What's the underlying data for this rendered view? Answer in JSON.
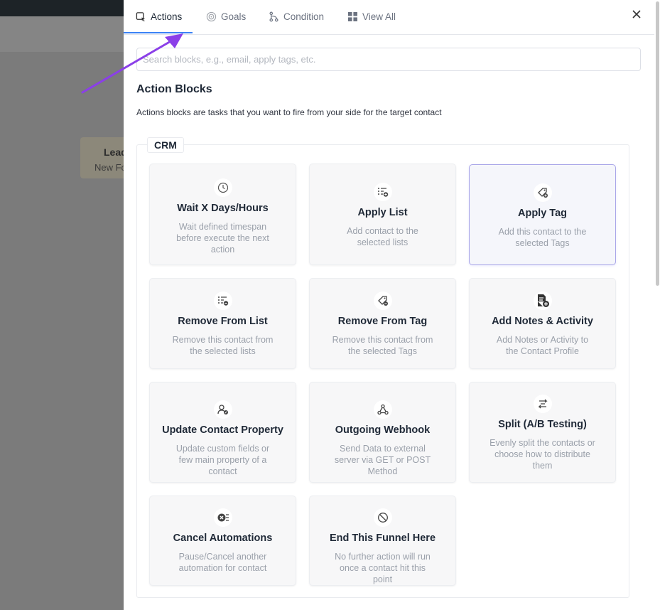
{
  "background": {
    "node_title": "Lead",
    "node_subtitle": "New Fo"
  },
  "tabs": [
    {
      "label": "Actions",
      "icon": "actions-icon",
      "active": true
    },
    {
      "label": "Goals",
      "icon": "target-icon",
      "active": false
    },
    {
      "label": "Condition",
      "icon": "branch-icon",
      "active": false
    },
    {
      "label": "View All",
      "icon": "grid-icon",
      "active": false
    }
  ],
  "search": {
    "placeholder": "Search blocks, e.g., email, apply tags, etc."
  },
  "section": {
    "title": "Action Blocks",
    "description": "Actions blocks are tasks that you want to fire from your side for the target contact"
  },
  "group": {
    "label": "CRM"
  },
  "cards": [
    {
      "title": "Wait X Days/Hours",
      "desc": "Wait defined timespan before execute the next action",
      "icon": "clock-icon"
    },
    {
      "title": "Apply List",
      "desc": "Add contact to the selected lists",
      "icon": "list-add-icon"
    },
    {
      "title": "Apply Tag",
      "desc": "Add this contact to the selected Tags",
      "icon": "tag-icon",
      "selected": true
    },
    {
      "title": "Remove From List",
      "desc": "Remove this contact from the selected lists",
      "icon": "list-remove-icon"
    },
    {
      "title": "Remove From Tag",
      "desc": "Remove this contact from the selected Tags",
      "icon": "tag-remove-icon"
    },
    {
      "title": "Add Notes & Activity",
      "desc": "Add Notes or Activity to the Contact Profile",
      "icon": "note-add-icon"
    },
    {
      "title": "Update Contact Property",
      "desc": "Update custom fields or few main property of a contact",
      "icon": "user-edit-icon"
    },
    {
      "title": "Outgoing Webhook",
      "desc": "Send Data to external server via GET or POST Method",
      "icon": "webhook-icon"
    },
    {
      "title": "Split (A/B Testing)",
      "desc": "Evenly split the contacts or choose how to distribute them",
      "icon": "split-icon"
    },
    {
      "title": "Cancel Automations",
      "desc": "Pause/Cancel another automation for contact",
      "icon": "cancel-automation-icon"
    },
    {
      "title": "End This Funnel Here",
      "desc": "No further action will run once a contact hit this point",
      "icon": "stop-icon"
    }
  ],
  "colors": {
    "accent": "#3b82f6",
    "selected_border": "#a9a6e8",
    "annotation_arrow": "#8b3fe8"
  }
}
